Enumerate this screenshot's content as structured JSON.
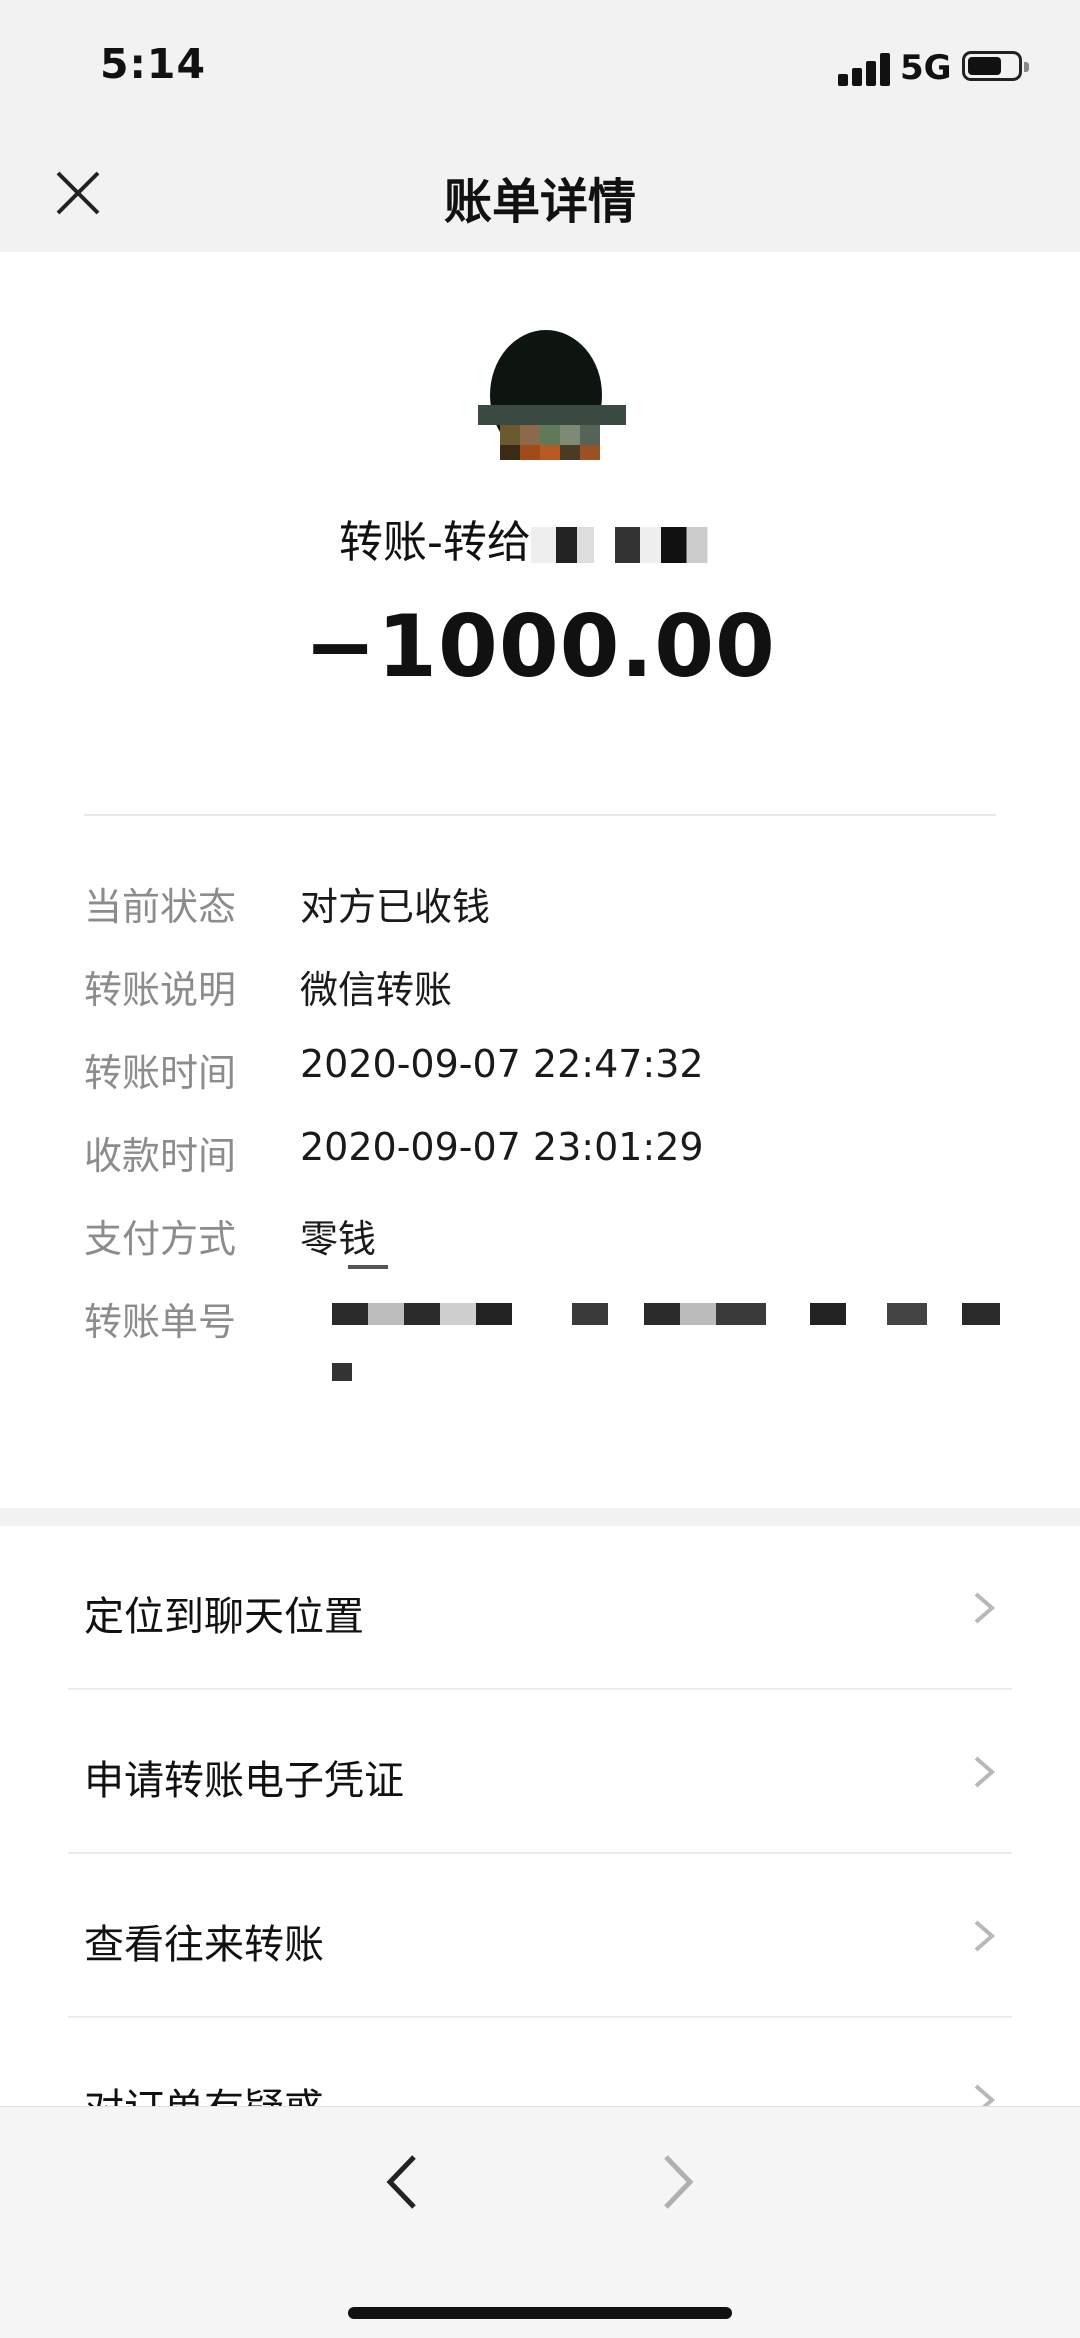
{
  "status_bar": {
    "time": "5:14",
    "network": "5G"
  },
  "nav": {
    "title": "账单详情"
  },
  "transaction": {
    "payee": "转账-转给",
    "amount": "−1000.00",
    "details": [
      {
        "label": "当前状态",
        "value": "对方已收钱"
      },
      {
        "label": "转账说明",
        "value": "微信转账"
      },
      {
        "label": "转账时间",
        "value": "2020-09-07 22:47:32"
      },
      {
        "label": "收款时间",
        "value": "2020-09-07 23:01:29"
      },
      {
        "label": "支付方式",
        "value": "零钱"
      },
      {
        "label": "转账单号",
        "value": ""
      }
    ]
  },
  "menu": {
    "items": [
      {
        "label": "定位到聊天位置"
      },
      {
        "label": "申请转账电子凭证"
      },
      {
        "label": "查看往来转账"
      },
      {
        "label": "对订单有疑惑"
      }
    ]
  },
  "colors": {
    "label_gray": "#8c8c8c",
    "background": "#f2f2f2",
    "card": "#ffffff"
  }
}
